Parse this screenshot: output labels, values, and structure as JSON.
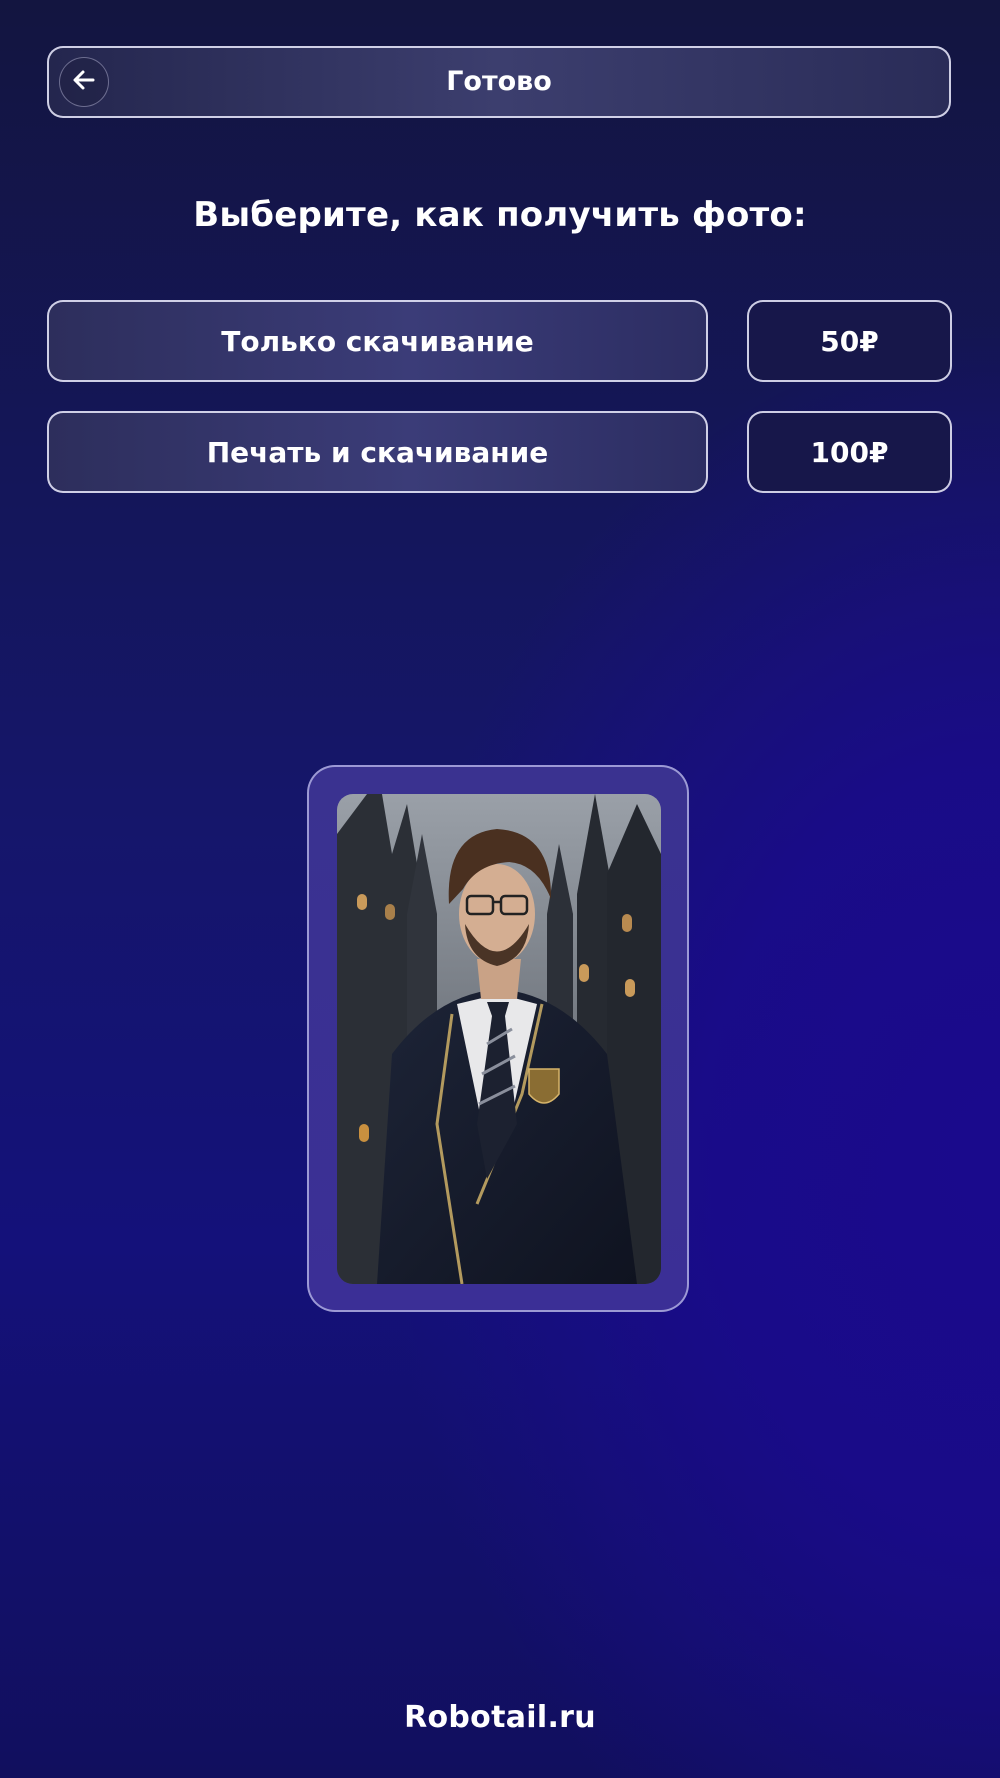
{
  "header": {
    "title": "Готово",
    "back_icon": "arrow-left-icon"
  },
  "prompt": "Выберите, как получить фото:",
  "options": [
    {
      "label": "Только скачивание",
      "price": "50₽"
    },
    {
      "label": "Печать и скачивание",
      "price": "100₽"
    }
  ],
  "photo": {
    "subject": "generated-portrait"
  },
  "footer": {
    "brand": "Robotail.ru"
  },
  "colors": {
    "background_top": "#131540",
    "background_accent": "#1a0a8c",
    "button_border": "#e1e1f5",
    "photo_frame": "#3a3290"
  }
}
